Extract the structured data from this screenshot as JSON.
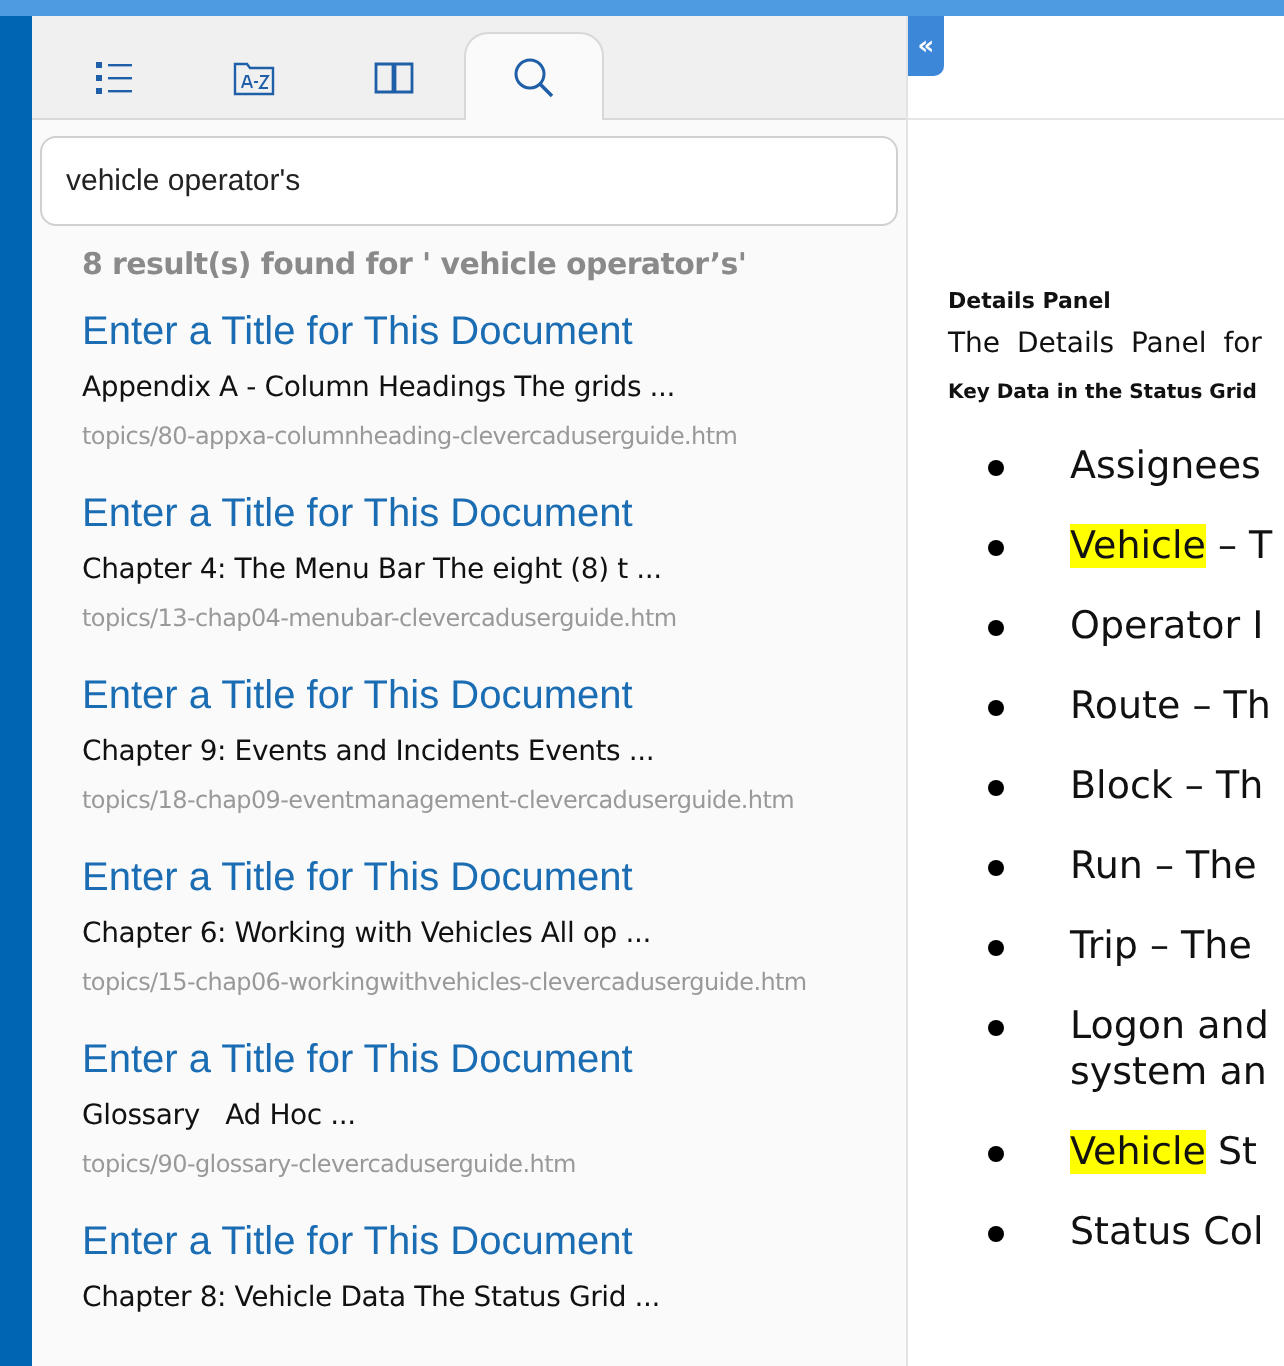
{
  "tabs": [
    {
      "kind": "contents",
      "selected": false
    },
    {
      "kind": "index",
      "selected": false
    },
    {
      "kind": "glossary",
      "selected": false
    },
    {
      "kind": "search",
      "selected": true
    }
  ],
  "search": {
    "value": "vehicle operator's"
  },
  "results_summary": "8 result(s) found for ' vehicle operator’s'",
  "results": [
    {
      "title": "Enter a Title for This Document",
      "snippet": "Appendix A - Column Headings The grids ...",
      "path": "topics/80-appxa-columnheading-clevercaduserguide.htm"
    },
    {
      "title": "Enter a Title for This Document",
      "snippet": "Chapter 4: The Menu Bar The eight (8) t ...",
      "path": "topics/13-chap04-menubar-clevercaduserguide.htm"
    },
    {
      "title": "Enter a Title for This Document",
      "snippet": "Chapter 9: Events and Incidents Events ...",
      "path": "topics/18-chap09-eventmanagement-clevercaduserguide.htm"
    },
    {
      "title": "Enter a Title for This Document",
      "snippet": "Chapter 6: Working with Vehicles All op ...",
      "path": "topics/15-chap06-workingwithvehicles-clevercaduserguide.htm"
    },
    {
      "title": "Enter a Title for This Document",
      "snippet": "Glossary   Ad Hoc ...",
      "path": "topics/90-glossary-clevercaduserguide.htm"
    },
    {
      "title": "Enter a Title for This Document",
      "snippet": "Chapter 8: Vehicle Data The Status Grid ..."
    }
  ],
  "collapse_button": "«",
  "document": {
    "heading": "Details Panel",
    "intro": "The Details Panel for",
    "subheading": "Key Data in the Status Grid",
    "bullets": [
      {
        "lines": [
          "Assignees"
        ]
      },
      {
        "highlight": "Vehicle",
        "lines": [
          " – T"
        ]
      },
      {
        "lines": [
          "Operator I"
        ]
      },
      {
        "lines": [
          "Route – Th"
        ]
      },
      {
        "lines": [
          "Block – Th"
        ]
      },
      {
        "lines": [
          "Run – The"
        ]
      },
      {
        "lines": [
          "Trip – The"
        ]
      },
      {
        "lines": [
          "Logon and",
          "system an"
        ]
      },
      {
        "highlight": "Vehicle",
        "lines": [
          " St"
        ]
      },
      {
        "lines": [
          "Status Col"
        ]
      }
    ]
  }
}
